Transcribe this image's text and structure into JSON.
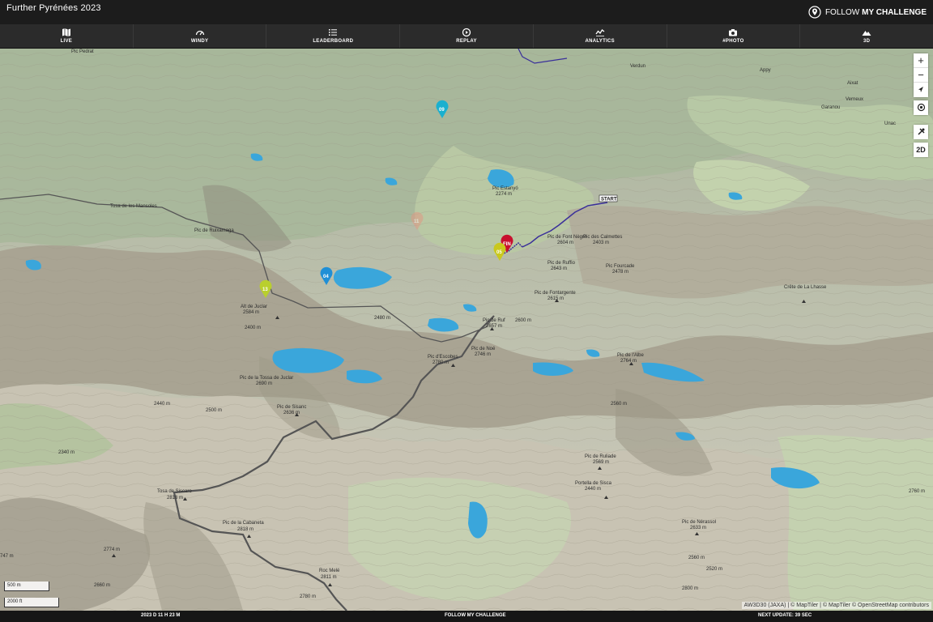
{
  "app": {
    "title": "Further Pyrénées 2023"
  },
  "brand": {
    "prefix": "FOLLOW",
    "name": "MY CHALLENGE",
    "icon": "map-pin-icon"
  },
  "nav": [
    {
      "label": "LIVE",
      "icon": "map-icon"
    },
    {
      "label": "WINDY",
      "icon": "gauge-icon"
    },
    {
      "label": "LEADERBOARD",
      "icon": "list-icon"
    },
    {
      "label": "REPLAY",
      "icon": "replay-icon"
    },
    {
      "label": "ANALYTICS",
      "icon": "analytics-icon"
    },
    {
      "label": "#PHOTO",
      "icon": "camera-icon"
    },
    {
      "label": "3D",
      "icon": "mountain-icon"
    }
  ],
  "map": {
    "controls": {
      "zoom_in": "+",
      "zoom_out": "−",
      "mode": "2D"
    },
    "scale": {
      "metric": "500 m",
      "imperial": "2000 ft"
    },
    "attribution": "AW3D30 (JAXA) | © MapTiler | © MapTiler © OpenStreetMap contributors",
    "start_label": "START",
    "markers": [
      {
        "label": "09",
        "color": "#1ab0cf"
      },
      {
        "label": "04",
        "color": "#1f8fd6"
      },
      {
        "label": "13",
        "color": "#b9cf2e"
      },
      {
        "label": "FIN",
        "color": "#c8102e"
      },
      {
        "label": "05",
        "color": "#c9c81e"
      },
      {
        "label": "11",
        "color": "#e09a85"
      }
    ],
    "places": [
      {
        "name": "Verdun"
      },
      {
        "name": "Aixat"
      },
      {
        "name": "Verneux"
      },
      {
        "name": "Unac"
      },
      {
        "name": "Garanou"
      },
      {
        "name": "Appy"
      },
      {
        "name": "Pic de Ruf",
        "elev": "2657 m"
      },
      {
        "name": "Pic d'Escobes",
        "elev": "2780 m"
      },
      {
        "name": "Pic de Sisanc",
        "elev": "2636 m"
      },
      {
        "name": "Pic de la Tossa de Juclar",
        "elev": "2690 m"
      },
      {
        "name": "Tosa de Siscaro",
        "elev": "2816 m"
      },
      {
        "name": "Pic de la Cabaneta",
        "elev": "2818 m"
      },
      {
        "name": "Roc Melé",
        "elev": "2811 m"
      },
      {
        "name": "Pic de Noé",
        "elev": "2746 m"
      },
      {
        "name": "Pic de l'Albe",
        "elev": "2764 m"
      },
      {
        "name": "Pic de Ruffio",
        "elev": "2643 m"
      },
      {
        "name": "Pic de Font Nègre",
        "elev": "2604 m"
      },
      {
        "name": "Pic des Calmettes",
        "elev": "2403 m"
      },
      {
        "name": "Pic Fourcade",
        "elev": "2478 m"
      },
      {
        "name": "Pic de Fontargente",
        "elev": "2615 m"
      },
      {
        "name": "Crête de La Lhasse",
        "elev": ""
      },
      {
        "name": "Pic de Ruliade",
        "elev": "2569 m"
      },
      {
        "name": "Portella de Sisca",
        "elev": "2440 m"
      },
      {
        "name": "Pic de Nérassol",
        "elev": "2633 m"
      },
      {
        "name": "Alt de Juclar",
        "elev": "2584 m"
      },
      {
        "name": "Pic Pedrat",
        "elev": ""
      },
      {
        "name": "Tosa de les Mansoles",
        "elev": ""
      },
      {
        "name": "Pic de Ruixamaga",
        "elev": ""
      },
      {
        "name": "Pic Estanyó",
        "elev": "2274 m"
      }
    ],
    "elevations": [
      "2774 m",
      "2660 m",
      "2780 m",
      "2560 m",
      "2520 m",
      "2440 m",
      "2500 m",
      "2480 m",
      "2400 m",
      "2600 m",
      "2340 m",
      "2560 m",
      "2760 m",
      "2800 m",
      "747 m"
    ]
  },
  "footer": {
    "elapsed": "2023 D 11 H 23 M",
    "center": "FOLLOW MY CHALLENGE",
    "next_update": "NEXT UPDATE: 39 SEC"
  }
}
